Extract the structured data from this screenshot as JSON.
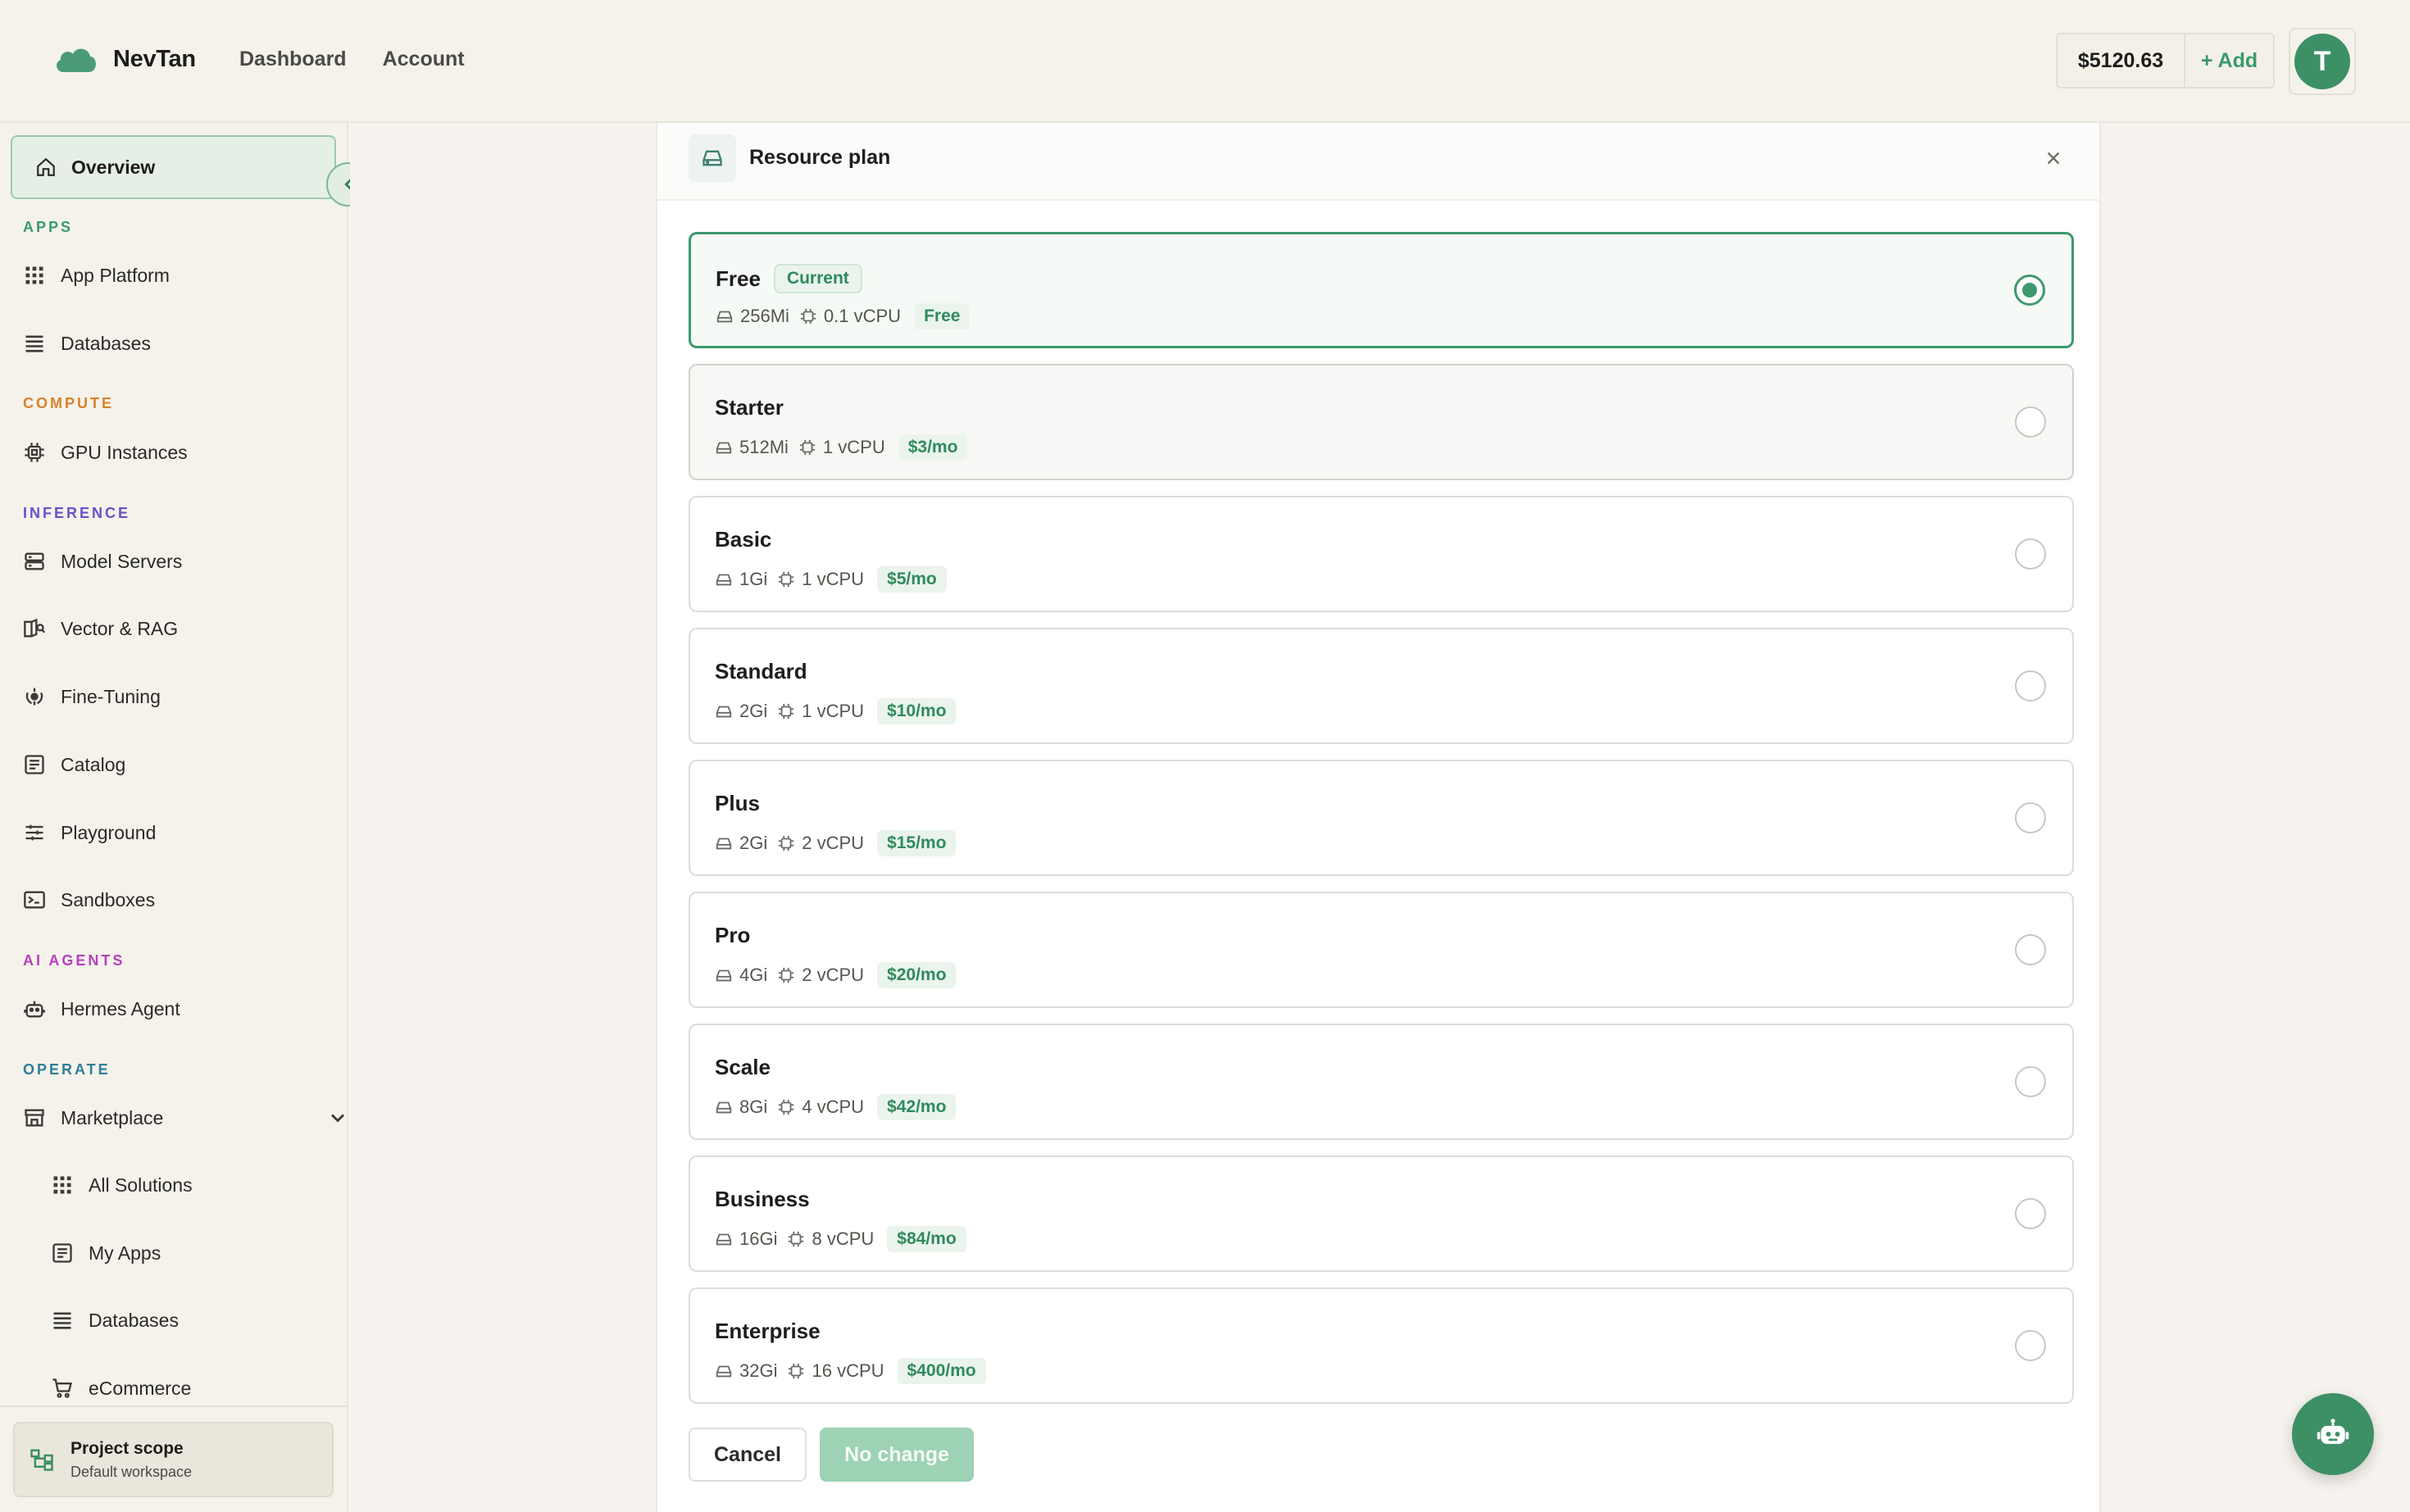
{
  "brand": {
    "name": "NevTan"
  },
  "topnav": {
    "dashboard": "Dashboard",
    "account": "Account"
  },
  "account": {
    "balance": "$5120.63",
    "add_label": "+ Add",
    "avatar_initial": "T"
  },
  "sidebar": {
    "overview": "Overview",
    "sections": {
      "apps": "APPS",
      "compute": "COMPUTE",
      "inference": "INFERENCE",
      "ai_agents": "AI AGENTS",
      "operate": "OPERATE"
    },
    "items": {
      "app_platform": "App Platform",
      "databases": "Databases",
      "gpu_instances": "GPU Instances",
      "model_servers": "Model Servers",
      "vector_rag": "Vector & RAG",
      "fine_tuning": "Fine-Tuning",
      "catalog": "Catalog",
      "playground": "Playground",
      "sandboxes": "Sandboxes",
      "hermes_agent": "Hermes Agent",
      "marketplace": "Marketplace",
      "all_solutions": "All Solutions",
      "my_apps": "My Apps",
      "mp_databases": "Databases",
      "ecommerce": "eCommerce"
    },
    "scope": {
      "title": "Project scope",
      "subtitle": "Default workspace"
    }
  },
  "panel": {
    "title": "Resource plan",
    "current_badge": "Current",
    "plans": [
      {
        "name": "Free",
        "memory": "256Mi",
        "cpu": "0.1 vCPU",
        "price": "Free",
        "selected": true
      },
      {
        "name": "Starter",
        "memory": "512Mi",
        "cpu": "1 vCPU",
        "price": "$3/mo"
      },
      {
        "name": "Basic",
        "memory": "1Gi",
        "cpu": "1 vCPU",
        "price": "$5/mo"
      },
      {
        "name": "Standard",
        "memory": "2Gi",
        "cpu": "1 vCPU",
        "price": "$10/mo"
      },
      {
        "name": "Plus",
        "memory": "2Gi",
        "cpu": "2 vCPU",
        "price": "$15/mo"
      },
      {
        "name": "Pro",
        "memory": "4Gi",
        "cpu": "2 vCPU",
        "price": "$20/mo"
      },
      {
        "name": "Scale",
        "memory": "8Gi",
        "cpu": "4 vCPU",
        "price": "$42/mo"
      },
      {
        "name": "Business",
        "memory": "16Gi",
        "cpu": "8 vCPU",
        "price": "$84/mo"
      },
      {
        "name": "Enterprise",
        "memory": "32Gi",
        "cpu": "16 vCPU",
        "price": "$400/mo"
      }
    ],
    "cancel_label": "Cancel",
    "confirm_label": "No change"
  },
  "colors": {
    "accent": "#3d9a6d",
    "apps_label": "#3a9a6c",
    "compute_label": "#d9822b",
    "inference_label": "#6b4fc9",
    "ai_agents_label": "#b83fbf",
    "operate_label": "#2f7e99"
  }
}
